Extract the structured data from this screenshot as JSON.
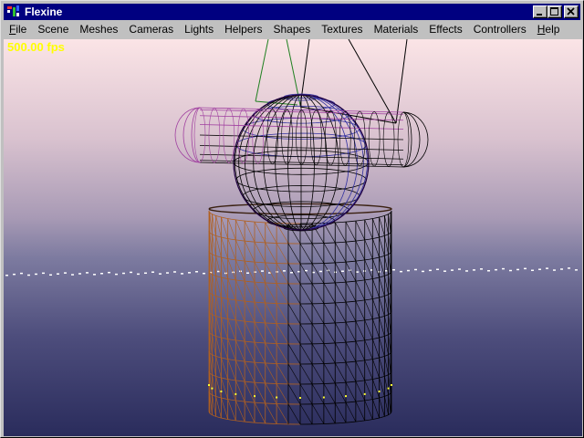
{
  "window": {
    "title": "Flexine",
    "icon": "flexine-app-icon",
    "controls": [
      "minimize",
      "maximize",
      "close"
    ]
  },
  "menubar": {
    "items": [
      {
        "label": "File",
        "accel": "F",
        "rest": "ile"
      },
      {
        "label": "Scene"
      },
      {
        "label": "Meshes"
      },
      {
        "label": "Cameras"
      },
      {
        "label": "Lights"
      },
      {
        "label": "Helpers"
      },
      {
        "label": "Shapes"
      },
      {
        "label": "Textures"
      },
      {
        "label": "Materials"
      },
      {
        "label": "Effects"
      },
      {
        "label": "Controllers"
      },
      {
        "label": "Help",
        "accel": "H",
        "rest": "elp"
      }
    ]
  },
  "viewport": {
    "fps_text": "500.00 fps",
    "colors": {
      "fps": "#ffff00",
      "wire_black": "#000000",
      "wire_magenta": "#a040a0",
      "wire_blue": "#3030a0",
      "wire_orange": "#b06020",
      "wire_green": "#208020",
      "horizon_dots": "#ffffff"
    },
    "objects": [
      "capsule-wireframe",
      "sphere-wireframe",
      "cylinder-wireframe",
      "camera-frustum-lines",
      "horizon-grid-dots"
    ]
  }
}
